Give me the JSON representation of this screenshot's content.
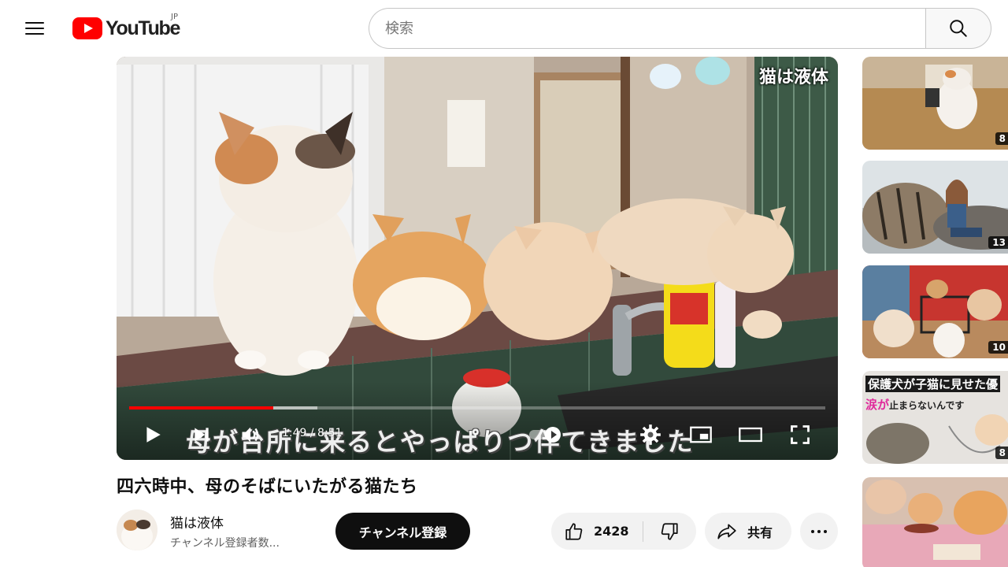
{
  "header": {
    "logo_text": "YouTube",
    "region": "JP",
    "search_placeholder": "検索"
  },
  "player": {
    "watermark": "猫は液体",
    "caption": "母が台所に来るとやっぱりつ伴てきました",
    "time": "1:49 / 8:51",
    "progress_fraction": 0.207,
    "buffered_fraction": 0.27,
    "autoplay_on": true
  },
  "video": {
    "title": "四六時中、母のそばにいたがる猫たち",
    "channel_name": "猫は液体",
    "subscriber_text": "チャンネル登録者数...",
    "subscribe_label": "チャンネル登録",
    "like_count": "2428",
    "share_label": "共有"
  },
  "sidebar": {
    "items": [
      {
        "duration": "8"
      },
      {
        "duration": "13"
      },
      {
        "duration": "10"
      },
      {
        "duration": "8",
        "overlay_line1": "保護犬が子猫に見せた優",
        "overlay_line2_pink": "涙が",
        "overlay_line2_rest": "止まらないんです"
      },
      {
        "duration": ""
      }
    ]
  },
  "colors": {
    "brand_red": "#ff0000",
    "progress_red": "#ff0000",
    "subscribe_bg": "#0f0f0f",
    "chip_bg": "#f2f2f2"
  }
}
